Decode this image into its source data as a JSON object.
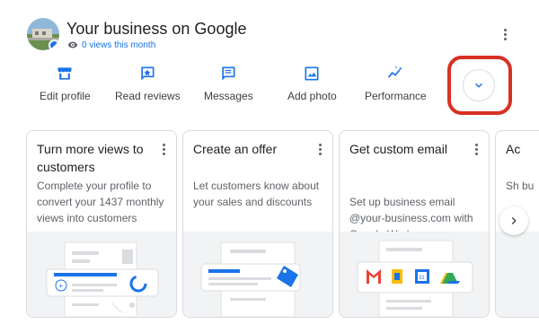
{
  "header": {
    "title": "Your business on Google",
    "views_text": "0 views this month",
    "menu_icon": "more-vert-icon"
  },
  "actions": [
    {
      "label": "Edit profile",
      "icon": "storefront-icon"
    },
    {
      "label": "Read reviews",
      "icon": "reviews-icon"
    },
    {
      "label": "Messages",
      "icon": "message-icon"
    },
    {
      "label": "Add photo",
      "icon": "photo-icon"
    },
    {
      "label": "Performance",
      "icon": "trending-icon"
    }
  ],
  "expand_button": {
    "icon": "chevron-down-icon",
    "highlight_color": "#d93025"
  },
  "cards": [
    {
      "title": "Turn more views to customers",
      "description": "Complete your profile to convert your 1437 monthly views into customers"
    },
    {
      "title": "Create an offer",
      "description": "Let customers know about your sales and discounts"
    },
    {
      "title": "Get custom email",
      "description": "Set up business email @your-business.com with Google Workspace"
    },
    {
      "title": "Ac",
      "description": "Sh bu"
    }
  ],
  "next_button": {
    "icon": "chevron-right-icon"
  },
  "colors": {
    "accent": "#1a73e8",
    "highlight": "#d93025",
    "text": "#202124",
    "secondary": "#5f6368",
    "border": "#dadce0"
  }
}
